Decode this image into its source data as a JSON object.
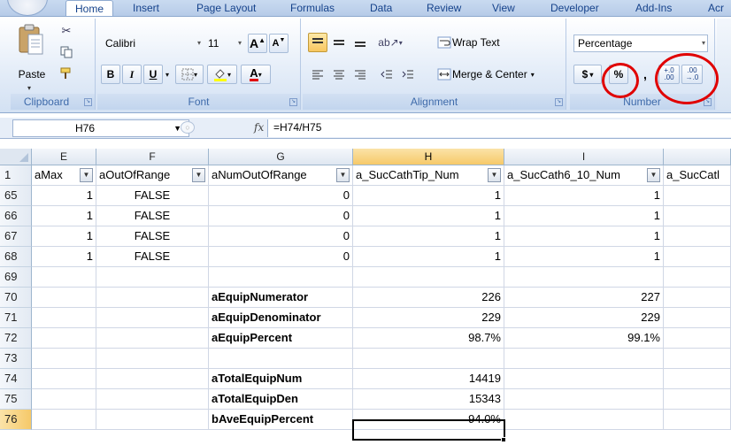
{
  "ribbon": {
    "tabs": [
      "Home",
      "Insert",
      "Page Layout",
      "Formulas",
      "Data",
      "Review",
      "View",
      "Developer",
      "Add-Ins",
      "Acr"
    ],
    "active_tab": "Home",
    "clipboard": {
      "paste_label": "Paste",
      "group_label": "Clipboard"
    },
    "font": {
      "name": "Calibri",
      "size": "11",
      "group_label": "Font",
      "bold": "B",
      "italic": "I",
      "underline": "U",
      "grow": "A",
      "shrink": "A"
    },
    "alignment": {
      "wrap_text": "Wrap Text",
      "merge_center": "Merge & Center",
      "group_label": "Alignment"
    },
    "number": {
      "format": "Percentage",
      "currency": "$",
      "percent": "%",
      "comma": ",",
      "inc_decimal": "+.0\n.00",
      "dec_decimal": ".00\n→.0",
      "group_label": "Number"
    }
  },
  "formula_bar": {
    "name_box": "H76",
    "fx": "fx",
    "formula": "=H74/H75"
  },
  "columns": [
    {
      "letter": "E",
      "header": "aMax"
    },
    {
      "letter": "F",
      "header": "aOutOfRange"
    },
    {
      "letter": "G",
      "header": "aNumOutOfRange"
    },
    {
      "letter": "H",
      "header": "a_SucCathTip_Num"
    },
    {
      "letter": "I",
      "header": "a_SucCath6_10_Num"
    },
    {
      "letter": "",
      "header": "a_SucCatl"
    }
  ],
  "rows": [
    {
      "num": "1",
      "cells": [
        "",
        "",
        "",
        "",
        "",
        ""
      ]
    },
    {
      "num": "65",
      "cells": [
        "1",
        "FALSE",
        "0",
        "1",
        "1",
        ""
      ]
    },
    {
      "num": "66",
      "cells": [
        "1",
        "FALSE",
        "0",
        "1",
        "1",
        ""
      ]
    },
    {
      "num": "67",
      "cells": [
        "1",
        "FALSE",
        "0",
        "1",
        "1",
        ""
      ]
    },
    {
      "num": "68",
      "cells": [
        "1",
        "FALSE",
        "0",
        "1",
        "1",
        ""
      ]
    },
    {
      "num": "69",
      "cells": [
        "",
        "",
        "",
        "",
        "",
        ""
      ]
    },
    {
      "num": "70",
      "cells": [
        "",
        "",
        "aEquipNumerator",
        "226",
        "227",
        ""
      ]
    },
    {
      "num": "71",
      "cells": [
        "",
        "",
        "aEquipDenominator",
        "229",
        "229",
        ""
      ]
    },
    {
      "num": "72",
      "cells": [
        "",
        "",
        "aEquipPercent",
        "98.7%",
        "99.1%",
        ""
      ]
    },
    {
      "num": "73",
      "cells": [
        "",
        "",
        "",
        "",
        "",
        ""
      ]
    },
    {
      "num": "74",
      "cells": [
        "",
        "",
        "aTotalEquipNum",
        "14419",
        "",
        ""
      ]
    },
    {
      "num": "75",
      "cells": [
        "",
        "",
        "aTotalEquipDen",
        "15343",
        "",
        ""
      ]
    },
    {
      "num": "76",
      "cells": [
        "",
        "",
        "bAveEquipPercent",
        "94.0%",
        "",
        ""
      ]
    }
  ],
  "selected_cell": "H76",
  "highlight_color": "#e00000"
}
